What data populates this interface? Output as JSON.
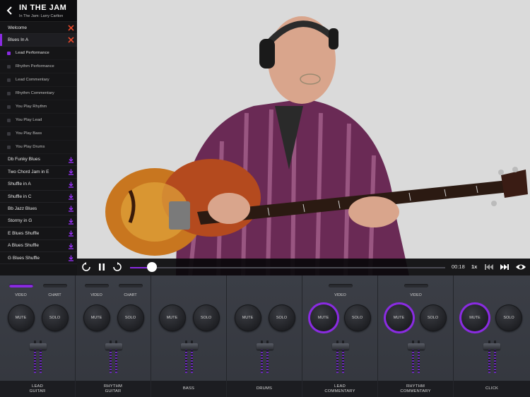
{
  "header": {
    "brand": "IN THE JAM",
    "subtitle": "In The Jam: Larry Carlton"
  },
  "sidebar": {
    "top_items": [
      {
        "label": "Welcome",
        "action": "close"
      },
      {
        "label": "Blues In A",
        "action": "close",
        "selected": true
      }
    ],
    "sub_items": [
      {
        "label": "Lead Performance",
        "active": true
      },
      {
        "label": "Rhythm Performance",
        "active": false
      },
      {
        "label": "Lead Commentary",
        "active": false
      },
      {
        "label": "Rhythm Commentary",
        "active": false
      },
      {
        "label": "You Play Rhythm",
        "active": false
      },
      {
        "label": "You Play Lead",
        "active": false
      },
      {
        "label": "You Play Bass",
        "active": false
      },
      {
        "label": "You Play Drums",
        "active": false
      }
    ],
    "jams": [
      {
        "label": "Db Funky Blues"
      },
      {
        "label": "Two Chord Jam in E"
      },
      {
        "label": "Shuffle in A"
      },
      {
        "label": "Shuffle in C"
      },
      {
        "label": "Bb Jazz Blues"
      },
      {
        "label": "Stormy in G"
      },
      {
        "label": "E Blues Shuffle"
      },
      {
        "label": "A Blues Shuffle"
      },
      {
        "label": "G Blues Shuffle"
      }
    ]
  },
  "player": {
    "time": "00:18",
    "speed": "1x",
    "progress_fraction": 0.07
  },
  "mixer": {
    "channels": [
      {
        "name": "LEAD\nGUITAR",
        "toggles": [
          {
            "label": "VIDEO",
            "on": true
          },
          {
            "label": "CHART",
            "on": false
          }
        ],
        "mute": "MUTE",
        "solo": "SOLO",
        "mute_lit": false
      },
      {
        "name": "RHYTHM\nGUITAR",
        "toggles": [
          {
            "label": "VIDEO",
            "on": false
          },
          {
            "label": "CHART",
            "on": false
          }
        ],
        "mute": "MUTE",
        "solo": "SOLO",
        "mute_lit": false
      },
      {
        "name": "BASS",
        "toggles": [],
        "mute": "MUTE",
        "solo": "SOLO",
        "mute_lit": false
      },
      {
        "name": "DRUMS",
        "toggles": [],
        "mute": "MUTE",
        "solo": "SOLO",
        "mute_lit": false
      },
      {
        "name": "LEAD\nCOMMENTARY",
        "toggles": [
          {
            "label": "VIDEO",
            "on": false
          }
        ],
        "mute": "MUTE",
        "solo": "SOLO",
        "mute_lit": true
      },
      {
        "name": "RHYTHM\nCOMMENTARY",
        "toggles": [
          {
            "label": "VIDEO",
            "on": false
          }
        ],
        "mute": "MUTE",
        "solo": "SOLO",
        "mute_lit": true
      },
      {
        "name": "CLICK",
        "toggles": [],
        "mute": "MUTE",
        "solo": "SOLO",
        "mute_lit": true
      }
    ]
  },
  "colors": {
    "accent": "#8a2be2",
    "download": "#9b30ff",
    "close": "#e8482b"
  }
}
